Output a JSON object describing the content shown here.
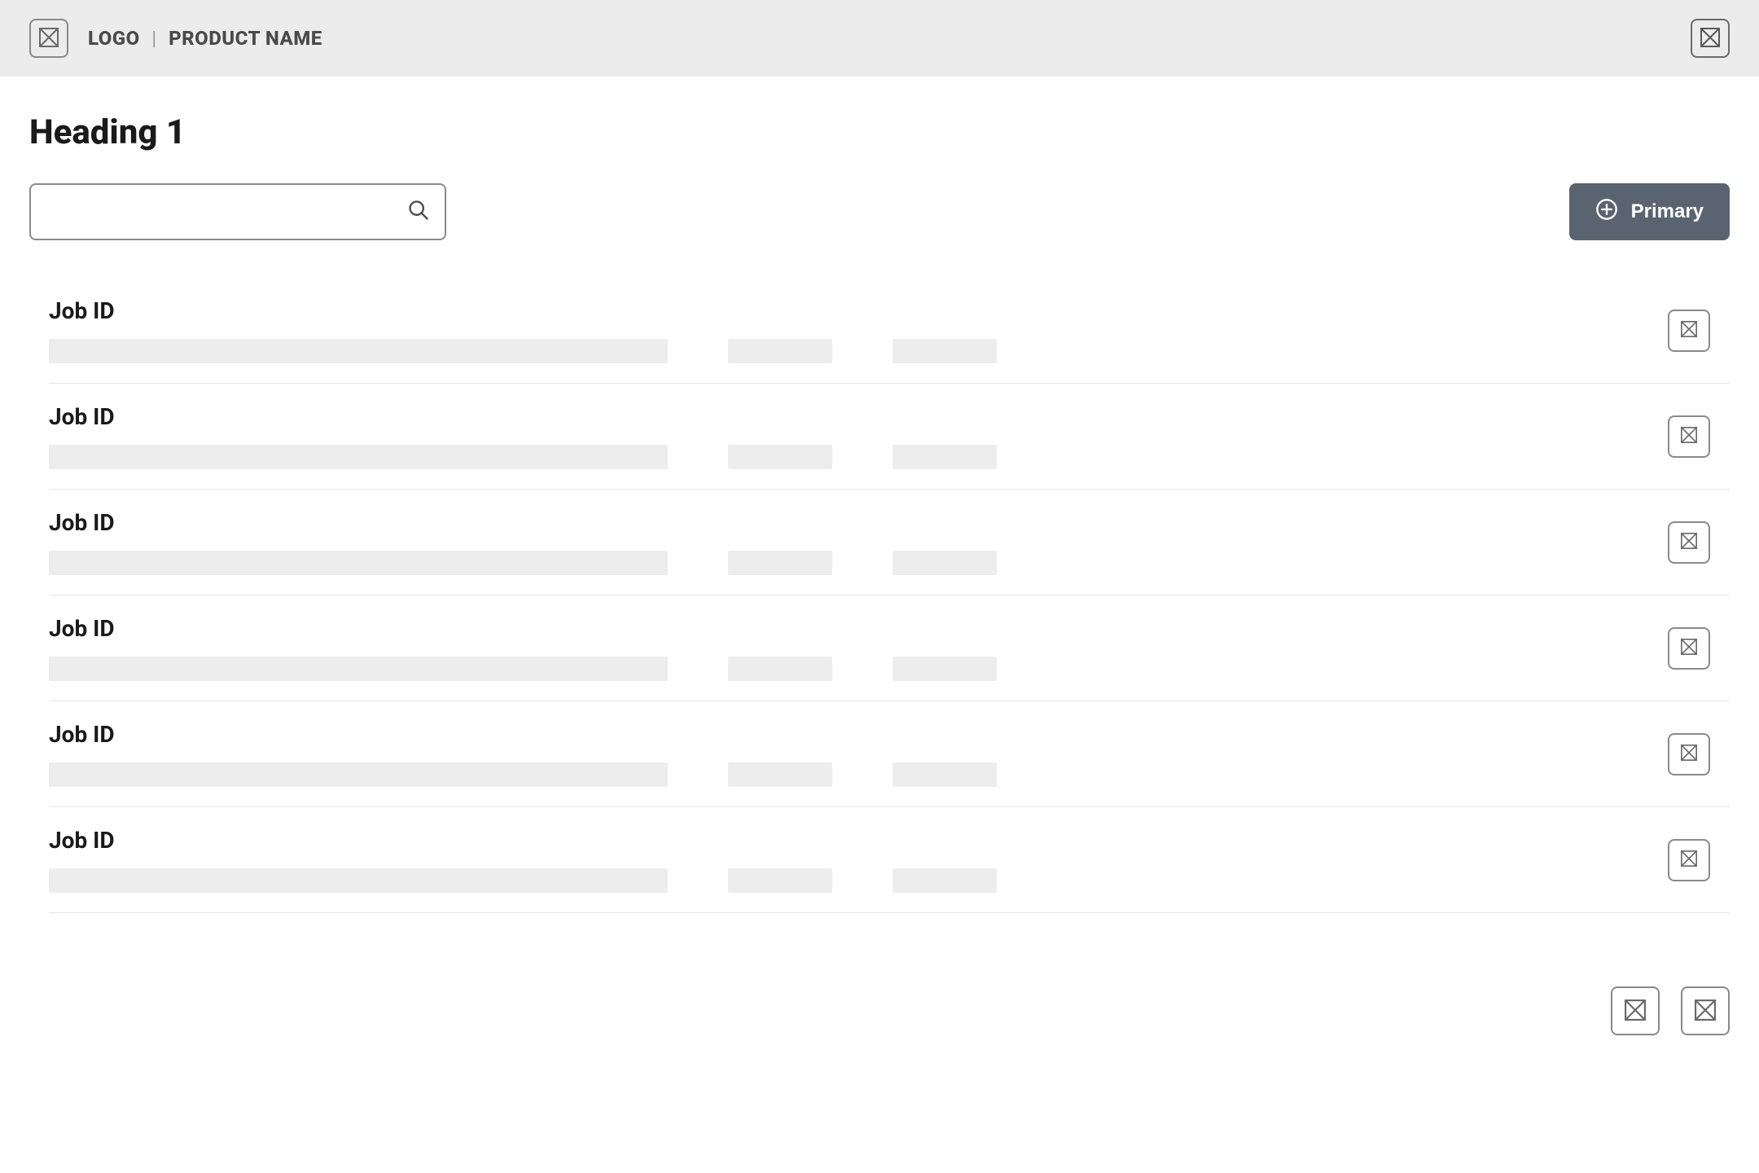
{
  "header": {
    "logo_text": "LOGO",
    "divider": "|",
    "product_name": "PRODUCT NAME"
  },
  "page": {
    "heading": "Heading 1"
  },
  "toolbar": {
    "search_value": "",
    "search_placeholder": "",
    "primary_label": "Primary"
  },
  "jobs": [
    {
      "title": "Job ID"
    },
    {
      "title": "Job ID"
    },
    {
      "title": "Job ID"
    },
    {
      "title": "Job ID"
    },
    {
      "title": "Job ID"
    },
    {
      "title": "Job ID"
    }
  ]
}
